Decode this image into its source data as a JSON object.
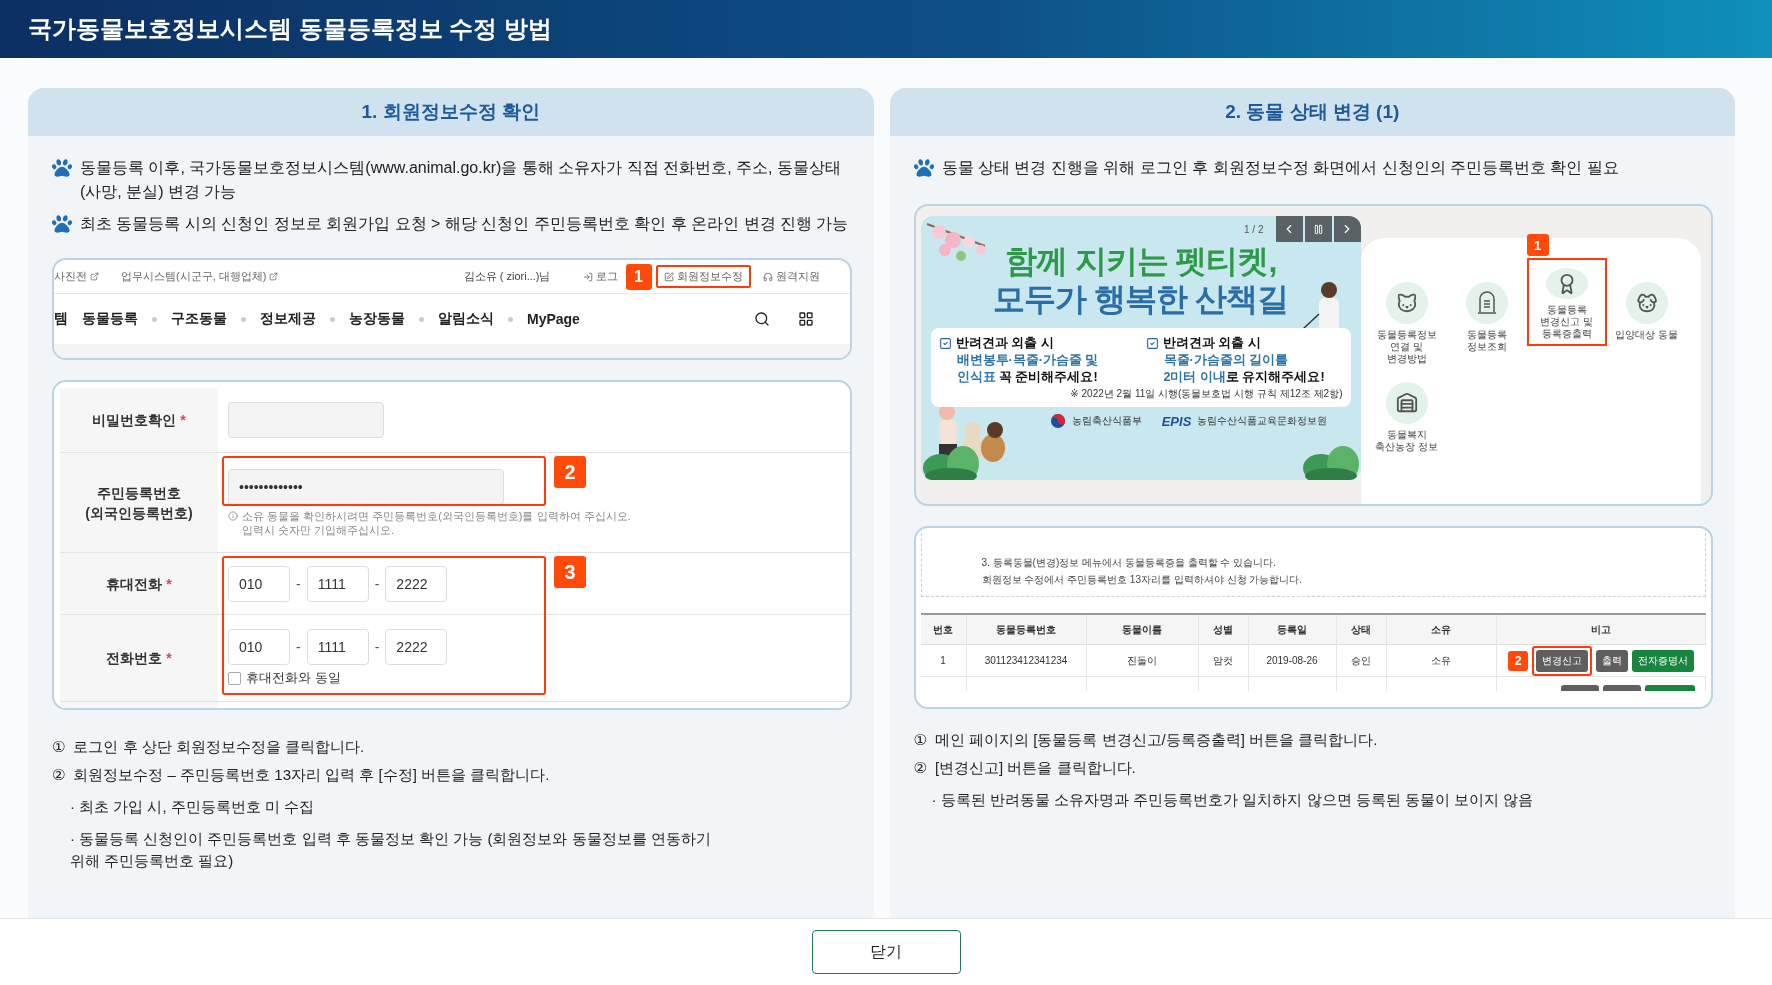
{
  "header": {
    "title": "국가동물보호정보시스템 동물등록정보 수정 방법"
  },
  "left": {
    "title": "1. 회원정보수정 확인",
    "bullets": [
      "동물등록 이후, 국가동물보호정보시스템(www.animal.go.kr)을 통해 소유자가 직접 전화번호, 주소, 동물상태 (사망, 분실) 변경 가능",
      "최초 동물등록 시의 신청인 정보로 회원가입 요청 > 해당 신청인 주민등록번호 확인 후 온라인 변경 진행 가능"
    ],
    "site": {
      "top_links": [
        "사진전",
        "업무시스템(시군구, 대행업체)"
      ],
      "user": "김소유 ( ziori...)님",
      "actions": [
        {
          "kind": "login",
          "label": "로그",
          "highlighted": false
        },
        {
          "kind": "edit",
          "label": "회원정보수정",
          "highlighted": true,
          "callout": "1"
        },
        {
          "kind": "support",
          "label": "원격지원",
          "highlighted": false
        }
      ],
      "menu": [
        "템",
        "동물등록",
        "구조동물",
        "정보제공",
        "농장동물",
        "알림소식",
        "MyPage"
      ]
    },
    "form": {
      "required_mark": "*",
      "separator": "-",
      "groups": [
        {
          "rows": [
            {
              "kind": "password",
              "label": "비밀번호확인",
              "required": true
            }
          ]
        },
        {
          "callout": "2",
          "rows": [
            {
              "kind": "id",
              "label": "주민등록번호\n(외국인등록번호)",
              "required": false,
              "value": "•••••••••••••",
              "hint": "소유 동물을 확인하시려면 주민등록번호(외국인등록번호)를 입력하여 주십시오.\n입력시 숫자만 기입해주십시오."
            }
          ]
        },
        {
          "callout": "3",
          "rows": [
            {
              "kind": "phone",
              "label": "휴대전화",
              "required": true,
              "parts": [
                "010",
                "1111",
                "2222"
              ]
            },
            {
              "kind": "phone",
              "label": "전화번호",
              "required": true,
              "parts": [
                "010",
                "1111",
                "2222"
              ],
              "same_as_mobile": {
                "label": "휴대전화와 동일",
                "checked": false
              }
            }
          ]
        }
      ]
    },
    "notes": [
      {
        "kind": "step",
        "marker": "①",
        "text": "로그인 후 상단 회원정보수정을 클릭합니다."
      },
      {
        "kind": "step",
        "marker": "②",
        "text": "회원정보수정 – 주민등록번호 13자리 입력 후 [수정] 버튼을 클릭합니다."
      },
      {
        "kind": "sub",
        "text": "· 최초 가입 시, 주민등록번호 미 수집"
      },
      {
        "kind": "sub",
        "text": "· 동물등록 신청인이 주민등록번호 입력 후 동물정보 확인 가능 (회원정보와 동물정보를 연동하기 위해 주민등록번호 필요)"
      }
    ]
  },
  "right": {
    "title": "2. 동물 상태 변경 (1)",
    "bullets": [
      "동물 상태 변경 진행을 위해 로그인 후 회원정보수정 화면에서 신청인의 주민등록번호 확인 필요"
    ],
    "banner": {
      "counter": "1 / 2",
      "title_lines": [
        {
          "text": "함께 지키는 펫티켓,",
          "color": "#2c9a48"
        },
        {
          "text": "모두가 행복한 산책길",
          "color": "#2a6ea6"
        }
      ],
      "boxes": [
        {
          "heading": "반려견과 외출 시",
          "lines": [
            [
              {
                "text": "배변봉투·목줄·가슴줄 및",
                "accent": true
              }
            ],
            [
              {
                "text": "인식표",
                "accent": true
              },
              {
                "text": " 꼭 준비해주세요!",
                "accent": false
              }
            ]
          ]
        },
        {
          "heading": "반려견과 외출 시",
          "lines": [
            [
              {
                "text": "목줄·가슴줄의 길이를",
                "accent": true
              }
            ],
            [
              {
                "text": "2미터 이내",
                "accent": true
              },
              {
                "text": "로 유지해주세요!",
                "accent": false
              }
            ]
          ],
          "note": "※ 2022년 2월 11일 시행(동물보호법 시행 규칙 제12조 제2항)"
        }
      ],
      "ministry": "농림축산식품부",
      "agency_mark": "EPIS",
      "agency": "농림수산식품교육문화정보원"
    },
    "menu": [
      {
        "kind": "cat",
        "label": "동물등록정보 연결 및 변경방법",
        "highlighted": false
      },
      {
        "kind": "tombstone",
        "label": "동물등록 정보조회",
        "highlighted": false
      },
      {
        "kind": "certificate",
        "label": "동물등록 변경신고 및 등록증출력",
        "highlighted": true,
        "callout": "1"
      },
      {
        "kind": "adoption",
        "label": "입양대상 동물",
        "highlighted": false
      },
      {
        "kind": "farm",
        "label": "동물복지 축산농장 정보",
        "highlighted": false
      }
    ],
    "notice": [
      "3. 등록동물(변경)정보 메뉴에서 동물등록증을 출력할 수 있습니다.",
      "회원정보 수정에서 주민등록번호 13자리를 입력하셔야 신청 가능합니다."
    ],
    "table": {
      "columns": [
        "번호",
        "동물등록번호",
        "동물이름",
        "성별",
        "등록일",
        "상태",
        "소유",
        "비고"
      ],
      "rows": [
        {
          "cells": [
            "1",
            "301123412341234",
            "진돌이",
            "암컷",
            "2019-08-26",
            "승인",
            "소유"
          ],
          "actions": [
            {
              "kind": "gray",
              "label": "변경신고",
              "callout": "2"
            },
            {
              "kind": "gray",
              "label": "출력"
            },
            {
              "kind": "green",
              "label": "전자증명서"
            }
          ]
        }
      ]
    },
    "notes": [
      {
        "kind": "step",
        "marker": "①",
        "text": "메인 페이지의 [동물등록 변경신고/등록증출력] 버튼을 클릭합니다."
      },
      {
        "kind": "step",
        "marker": "②",
        "text": "[변경신고] 버튼을 클릭합니다."
      },
      {
        "kind": "sub",
        "text": "· 등록된 반려동물 소유자명과 주민등록번호가 일치하지 않으면 등록된 동물이 보이지 않음"
      }
    ]
  },
  "footer": {
    "close": "닫기"
  }
}
